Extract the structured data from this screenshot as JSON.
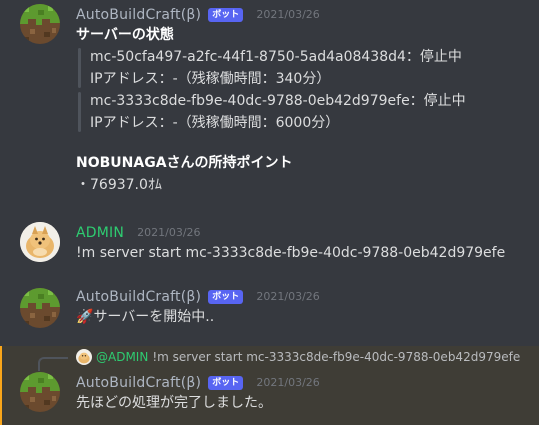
{
  "messages": [
    {
      "username": "AutoBuildCraft(β)",
      "bot_tag": "ボット",
      "timestamp": "2021/03/26",
      "title": "サーバーの状態",
      "servers": [
        {
          "line1": "mc-50cfa497-a2fc-44f1-8750-5ad4a08438d4：停止中",
          "line2": "IPアドレス：-（残稼働時間：340分）"
        },
        {
          "line1": "mc-3333c8de-fb9e-40dc-9788-0eb42d979efe：停止中",
          "line2": "IPアドレス：-（残稼働時間：6000分）"
        }
      ],
      "points_title": "NOBUNAGAさんの所持ポイント",
      "points_value": "・76937.0ｵﾑ"
    },
    {
      "username": "ADMIN",
      "timestamp": "2021/03/26",
      "text": "!m server start mc-3333c8de-fb9e-40dc-9788-0eb42d979efe"
    },
    {
      "username": "AutoBuildCraft(β)",
      "bot_tag": "ボット",
      "timestamp": "2021/03/26",
      "emoji": "🚀",
      "text": "サーバーを開始中.."
    },
    {
      "reply_mention": "@ADMIN",
      "reply_text": "!m server start mc-3333c8de-fb9e-40dc-9788-0eb42d979efe",
      "username": "AutoBuildCraft(β)",
      "bot_tag": "ボット",
      "timestamp": "2021/03/26",
      "text": "先ほどの処理が完了しました。"
    }
  ],
  "colors": {
    "background": "#36393f",
    "bot_tag": "#5865f2",
    "admin_name": "#2ecc71",
    "bot_name": "#aeb6c2",
    "highlight_border": "#faa61a"
  },
  "icons": {
    "bot_avatar": "minecraft-grass-block-icon",
    "admin_avatar": "dog-avatar-icon",
    "rocket": "rocket-emoji"
  }
}
